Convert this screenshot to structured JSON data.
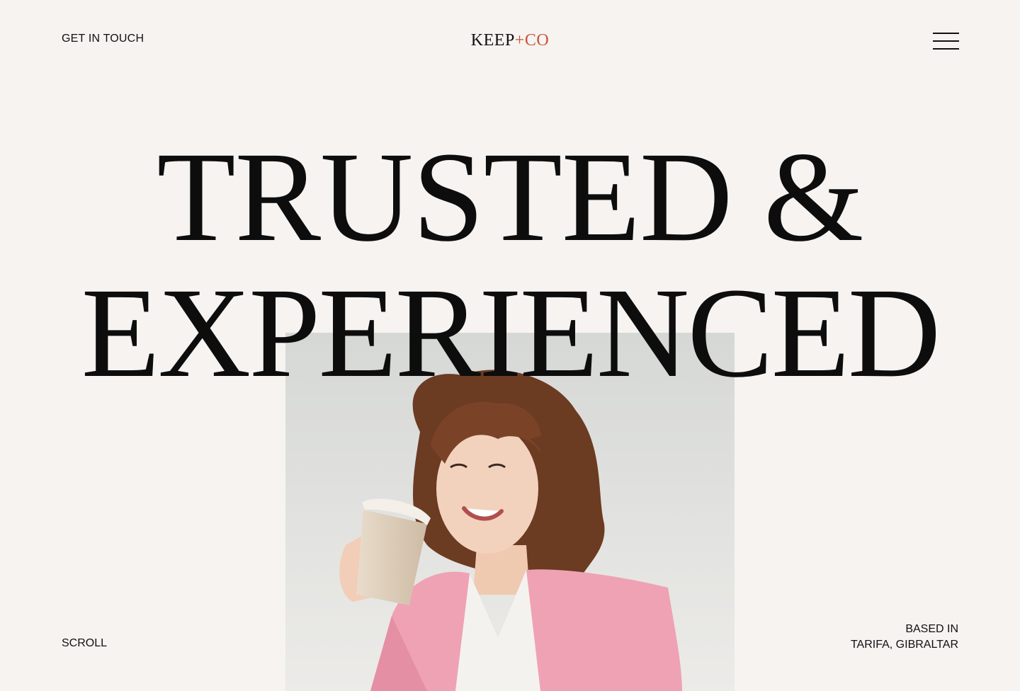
{
  "header": {
    "contact_label": "GET IN TOUCH",
    "logo": {
      "part1": "KEEP",
      "plus": "+",
      "part2": "CO"
    },
    "menu_icon": "hamburger-menu-icon"
  },
  "hero": {
    "headline_line1": "TRUSTED &",
    "headline_line2": "EXPERIENCED"
  },
  "footer": {
    "scroll_label": "SCROLL",
    "location_label": "BASED IN",
    "location_value": "TARIFA, GIBRALTAR"
  },
  "colors": {
    "background": "#f6f3f1",
    "text": "#111111",
    "accent": "#c8563a",
    "jacket": "#efa2b4"
  }
}
